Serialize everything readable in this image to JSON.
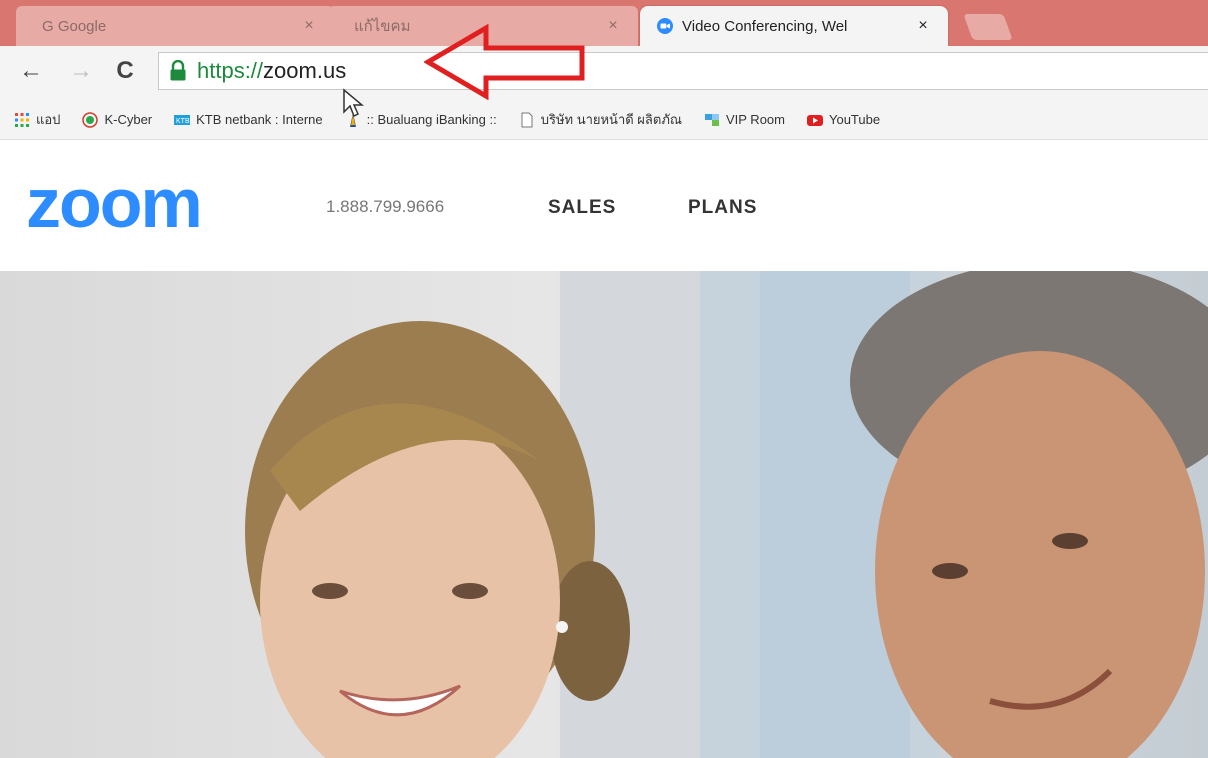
{
  "browser": {
    "tabs": [
      {
        "title": "G Google",
        "close": "×",
        "state": "inactive"
      },
      {
        "title": "แก้ไขคม",
        "close": "×",
        "state": "inactive"
      },
      {
        "title": "Video Conferencing, Wel",
        "close": "×",
        "state": "active"
      }
    ],
    "toolbar": {
      "back": "←",
      "forward": "→",
      "reload": "C",
      "url_scheme": "https://",
      "url_host": "zoom.us"
    },
    "bookmarks": [
      {
        "label": "แอป",
        "icon": "apps-grid-icon"
      },
      {
        "label": "K-Cyber",
        "icon": "kbank-icon"
      },
      {
        "label": "KTB netbank : Interne",
        "icon": "ktb-icon"
      },
      {
        "label": ":: Bualuang iBanking ::",
        "icon": "bualuang-icon"
      },
      {
        "label": "บริษัท นายหน้าดี ผลิตภัณ",
        "icon": "page-icon"
      },
      {
        "label": "VIP Room",
        "icon": "vip-room-icon"
      },
      {
        "label": "YouTube",
        "icon": "youtube-icon"
      }
    ]
  },
  "site": {
    "logo": "zoom",
    "phone": "1.888.799.9666",
    "nav": {
      "sales": "SALES",
      "plans": "PLANS"
    }
  },
  "colors": {
    "tabstrip": "#d9766f",
    "zoom_blue": "#2d8cff",
    "secure_green": "#1e8a3c",
    "annotation_red": "#e02020"
  }
}
